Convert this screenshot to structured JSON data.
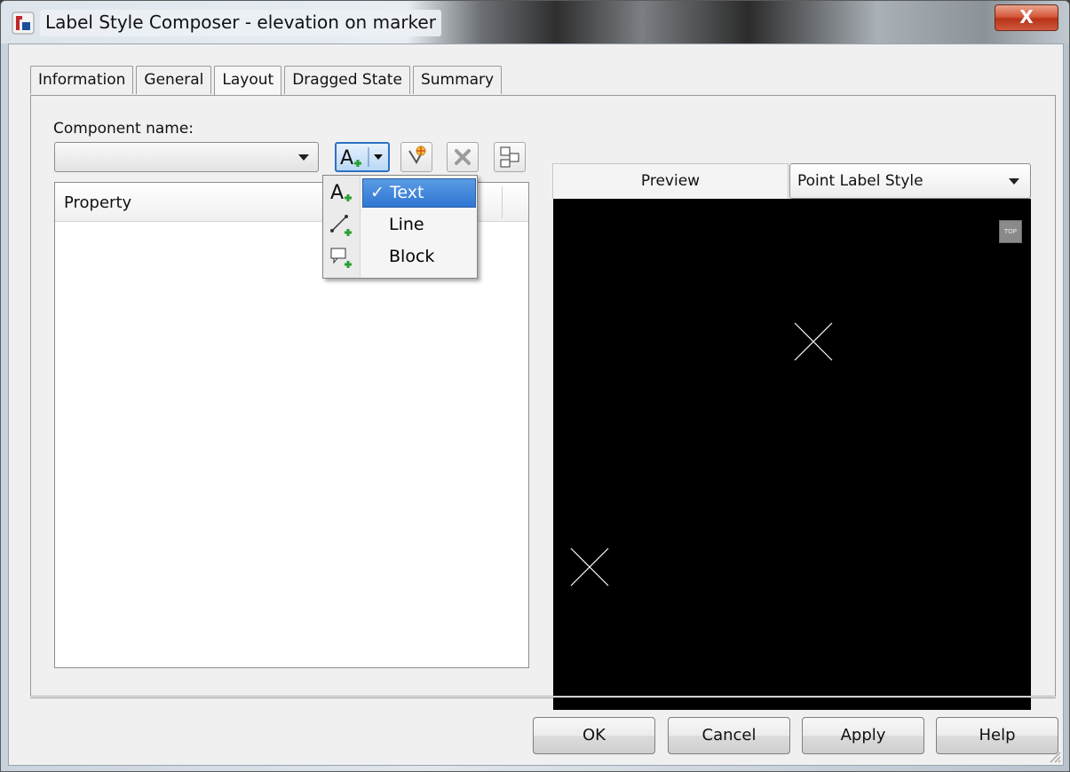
{
  "window": {
    "title": "Label Style Composer - elevation on marker",
    "close_label": "X",
    "app_icon": "civil3d-app-icon"
  },
  "tabs": [
    {
      "label": "Information",
      "active": false
    },
    {
      "label": "General",
      "active": false
    },
    {
      "label": "Layout",
      "active": true
    },
    {
      "label": "Dragged State",
      "active": false
    },
    {
      "label": "Summary",
      "active": false
    }
  ],
  "layout": {
    "component_name_label": "Component name:",
    "component_name_value": "",
    "toolbar": {
      "create_component_icon": "text-add-icon",
      "copy_component_icon": "copy-component-icon",
      "delete_component_icon": "delete-component-icon",
      "component_draw_order_icon": "draw-order-icon"
    },
    "component_type_menu": {
      "items": [
        {
          "label": "Text",
          "checked": true,
          "icon": "text-add-icon"
        },
        {
          "label": "Line",
          "checked": false,
          "icon": "line-add-icon"
        },
        {
          "label": "Block",
          "checked": false,
          "icon": "block-add-icon"
        }
      ]
    },
    "property_grid": {
      "header_property": "Property"
    }
  },
  "preview": {
    "tab_label": "Preview",
    "style_selected": "Point Label Style",
    "viewcube_label": "TOP",
    "background": "#000000"
  },
  "buttons": {
    "ok": "OK",
    "cancel": "Cancel",
    "apply": "Apply",
    "help": "Help"
  }
}
